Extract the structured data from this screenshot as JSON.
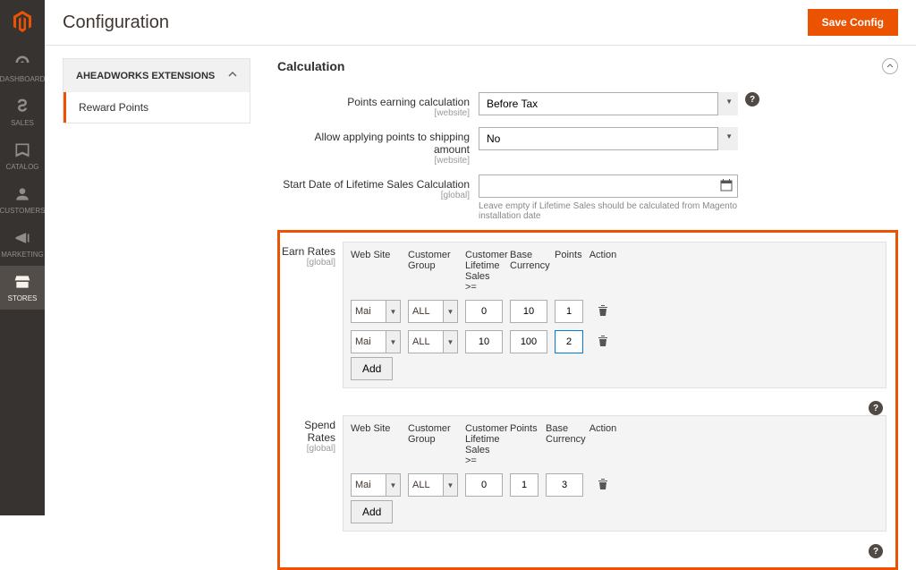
{
  "header": {
    "title": "Configuration",
    "save_btn": "Save Config"
  },
  "nav": {
    "dashboard": "DASHBOARD",
    "sales": "SALES",
    "catalog": "CATALOG",
    "customers": "CUSTOMERS",
    "marketing": "MARKETING",
    "stores": "STORES"
  },
  "config_nav": {
    "section": "AHEADWORKS EXTENSIONS",
    "item": "Reward Points"
  },
  "section": {
    "title": "Calculation"
  },
  "fields": {
    "points_calc": {
      "label": "Points earning calculation",
      "scope": "[website]",
      "value": "Before Tax"
    },
    "shipping": {
      "label": "Allow applying points to shipping amount",
      "scope": "[website]",
      "value": "No"
    },
    "start_date": {
      "label": "Start Date of Lifetime Sales Calculation",
      "scope": "[global]",
      "value": "",
      "note": "Leave empty if Lifetime Sales should be calculated from Magento installation date"
    },
    "earn_rates": {
      "label": "Earn Rates",
      "scope": "[global]"
    },
    "spend_rates": {
      "label": "Spend Rates",
      "scope": "[global]"
    }
  },
  "earn_headers": {
    "ws": "Web Site",
    "cg": "Customer Group",
    "sales": "Customer Lifetime Sales >=",
    "bc": "Base Currency",
    "pts": "Points",
    "act": "Action"
  },
  "spend_headers": {
    "ws": "Web Site",
    "cg": "Customer Group",
    "sales": "Customer Lifetime Sales >=",
    "pts": "Points",
    "bc": "Base Currency",
    "act": "Action"
  },
  "earn_rows": [
    {
      "ws": "Mai",
      "cg": "ALL",
      "sales": "0",
      "bc": "10",
      "pts": "1"
    },
    {
      "ws": "Mai",
      "cg": "ALL",
      "sales": "10",
      "bc": "100",
      "pts": "2"
    }
  ],
  "spend_rows": [
    {
      "ws": "Mai",
      "cg": "ALL",
      "sales": "0",
      "pts": "1",
      "bc": "3"
    }
  ],
  "buttons": {
    "add": "Add"
  }
}
